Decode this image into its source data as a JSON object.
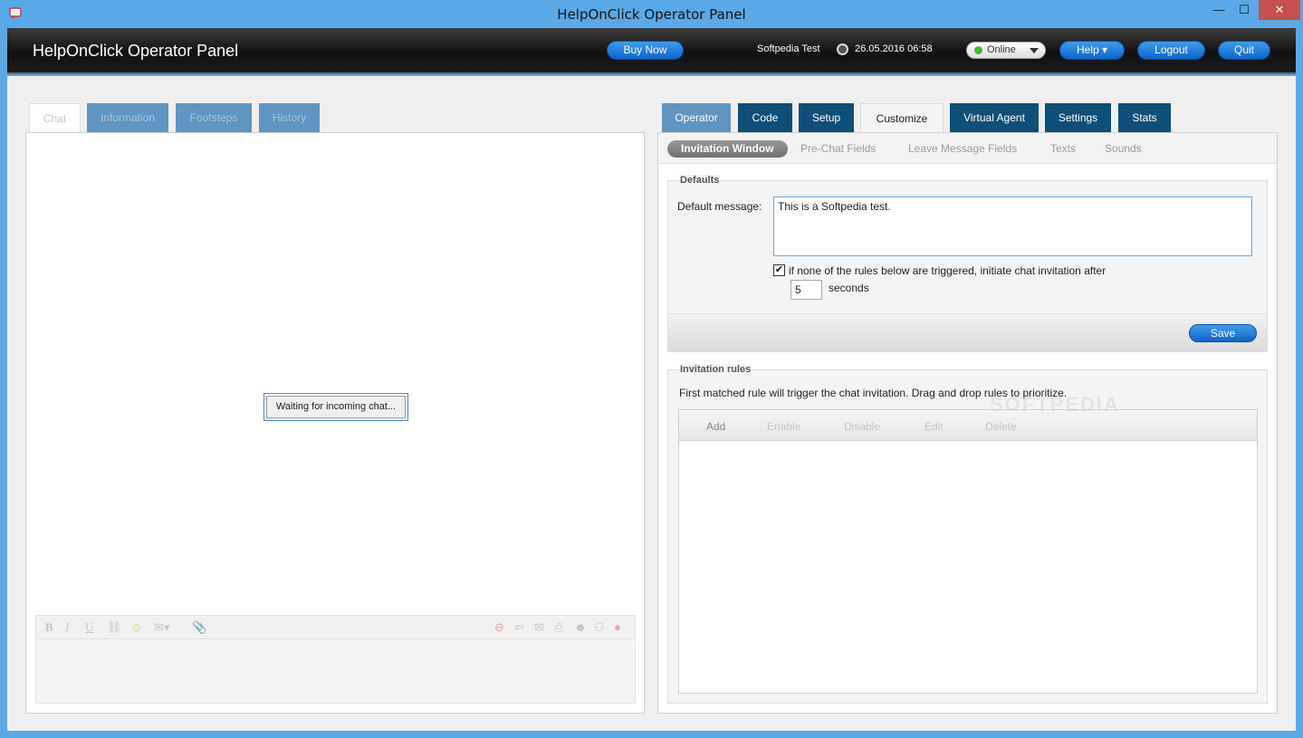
{
  "window": {
    "title": "HelpOnClick Operator Panel",
    "minimize": "—",
    "maximize": "☐",
    "close": "✕"
  },
  "header": {
    "app_title": "HelpOnClick Operator Panel",
    "buy_now": "Buy Now",
    "user": "Softpedia Test",
    "datetime": "26.05.2016 06:58",
    "status": "Online",
    "help": "Help ▾",
    "logout": "Logout",
    "quit": "Quit"
  },
  "left": {
    "tabs": [
      "Chat",
      "Information",
      "Footsteps",
      "History"
    ],
    "waiting_text": "Waiting for incoming chat...",
    "toolbar_icons": [
      "bold-icon",
      "italic-icon",
      "underline-icon",
      "link-icon",
      "smiley-icon",
      "canned-response-icon",
      "attach-icon",
      "stop-icon",
      "transfer-icon",
      "email-icon",
      "print-icon",
      "invite-operator-icon",
      "join-icon",
      "close-chat-icon"
    ]
  },
  "right": {
    "tabs": [
      "Operator",
      "Code",
      "Setup",
      "Customize",
      "Virtual Agent",
      "Settings",
      "Stats"
    ],
    "subtabs": [
      "Invitation Window",
      "Pre-Chat Fields",
      "Leave Message Fields",
      "Texts",
      "Sounds"
    ],
    "defaults": {
      "legend": "Defaults",
      "message_label": "Default message:",
      "message_value": "This is a Softpedia test.",
      "checkbox_label": "if none of the rules below are triggered, initiate chat invitation after",
      "seconds_value": "5",
      "seconds_label": "seconds",
      "save": "Save"
    },
    "rules": {
      "legend": "Invitation rules",
      "description": "First matched rule will trigger the chat invitation. Drag and drop rules to prioritize.",
      "buttons": [
        "Add",
        "Enable",
        "Disable",
        "Edit",
        "Delete"
      ]
    }
  },
  "watermark": "SOFTPEDIA",
  "colors": {
    "accent": "#0d4f78",
    "light_tab": "#5f95c2",
    "button_blue": "#1a74d6",
    "online": "#4ab635"
  }
}
